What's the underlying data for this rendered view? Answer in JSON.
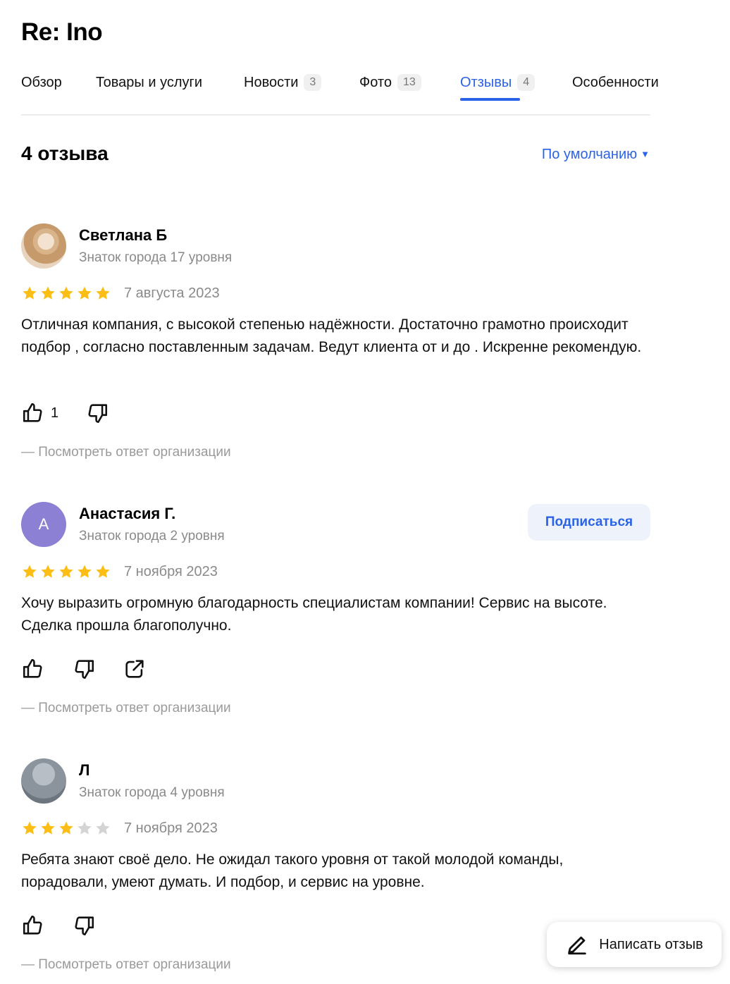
{
  "header": {
    "title": "Re: Ino"
  },
  "tabs": [
    {
      "label": "Обзор"
    },
    {
      "label": "Товары и услуги"
    },
    {
      "label": "Новости",
      "count": "3"
    },
    {
      "label": "Фото",
      "count": "13"
    },
    {
      "label": "Отзывы",
      "count": "4",
      "active": true
    },
    {
      "label": "Особенности"
    }
  ],
  "reviews_header": {
    "count_label": "4 отзыва",
    "sort_label": "По умолчанию"
  },
  "reviews": [
    {
      "author": "Светлана Б",
      "level": "Знаток города 17 уровня",
      "rating": 5,
      "date": "7 августа 2023",
      "text": "Отличная компания, с высокой степенью надёжности. Достаточно грамотно происходит подбор , согласно поставленным задачам. Ведут клиента от и до . Искренне рекомендую.",
      "likes": "1",
      "answer_link": "— Посмотреть ответ организации"
    },
    {
      "author": "Анастасия Г.",
      "avatar_letter": "А",
      "level": "Знаток города 2 уровня",
      "rating": 5,
      "date": "7 ноября 2023",
      "text": "Хочу выразить огромную благодарность специалистам компании! Сервис на высоте. Сделка прошла благополучно.",
      "subscribe_label": "Подписаться",
      "answer_link": "— Посмотреть ответ организации"
    },
    {
      "author": "Л",
      "level": "Знаток города 4 уровня",
      "rating": 3,
      "date": "7 ноября 2023",
      "text": "Ребята знают своё дело. Не ожидал такого уровня от такой молодой команды, порадовали, умеют думать. И подбор, и сервис на уровне.",
      "answer_link": "— Посмотреть ответ организации"
    }
  ],
  "write_review": {
    "label": "Написать отзыв",
    "icon": "pencil-icon"
  },
  "colors": {
    "accent": "#2b63e8",
    "star": "#fcbe15",
    "star_empty": "#d4d4d4"
  }
}
